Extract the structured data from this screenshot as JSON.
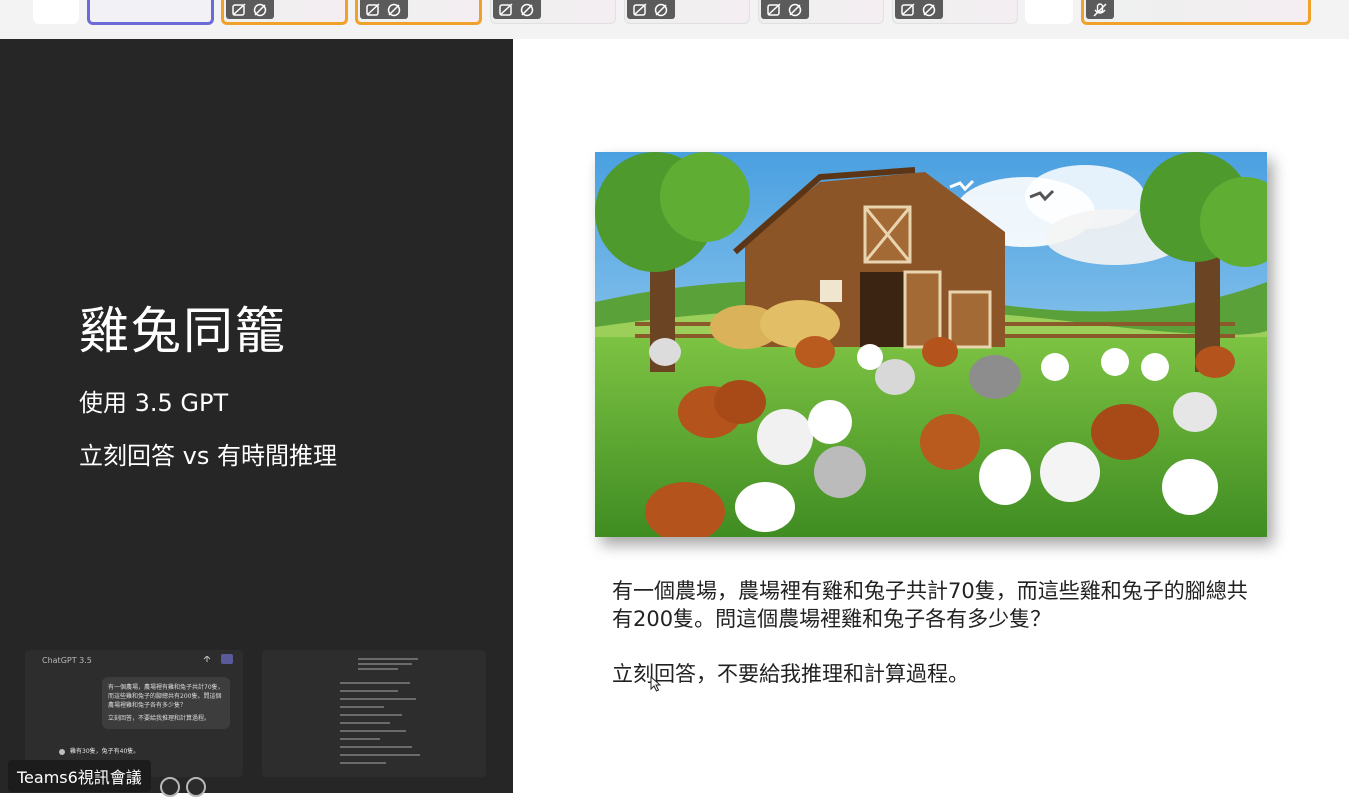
{
  "slide": {
    "title": "雞兔同籠",
    "subtitle": "使用 3.5 GPT",
    "tagline": "立刻回答 vs 有時間推理",
    "question": "有一個農場，農場裡有雞和兔子共計70隻，而這些雞和兔子的腳總共有200隻。問這個農場裡雞和兔子各有多少隻？",
    "instruction": "立刻回答，不要給我推理和計算過程。"
  },
  "thumbnail": {
    "model_label": "ChatGPT 3.5",
    "prompt": "有一個農場，農場裡有雞和兔子共計70隻，而這些雞和兔子的腳總共有200隻。問這個農場裡雞和兔子各有多少隻？",
    "instruction": "立刻回答，不要給我推理和計算過程。",
    "answer": "雞有30隻，兔子有40隻。"
  },
  "meeting": {
    "label": "Teams6視訊會議"
  },
  "colors": {
    "active_speaker_border": "#f0a12a",
    "self_tile_border": "#6b6bd8",
    "left_panel_bg": "#262626",
    "tile_control_bg": "#5b5b5b"
  }
}
